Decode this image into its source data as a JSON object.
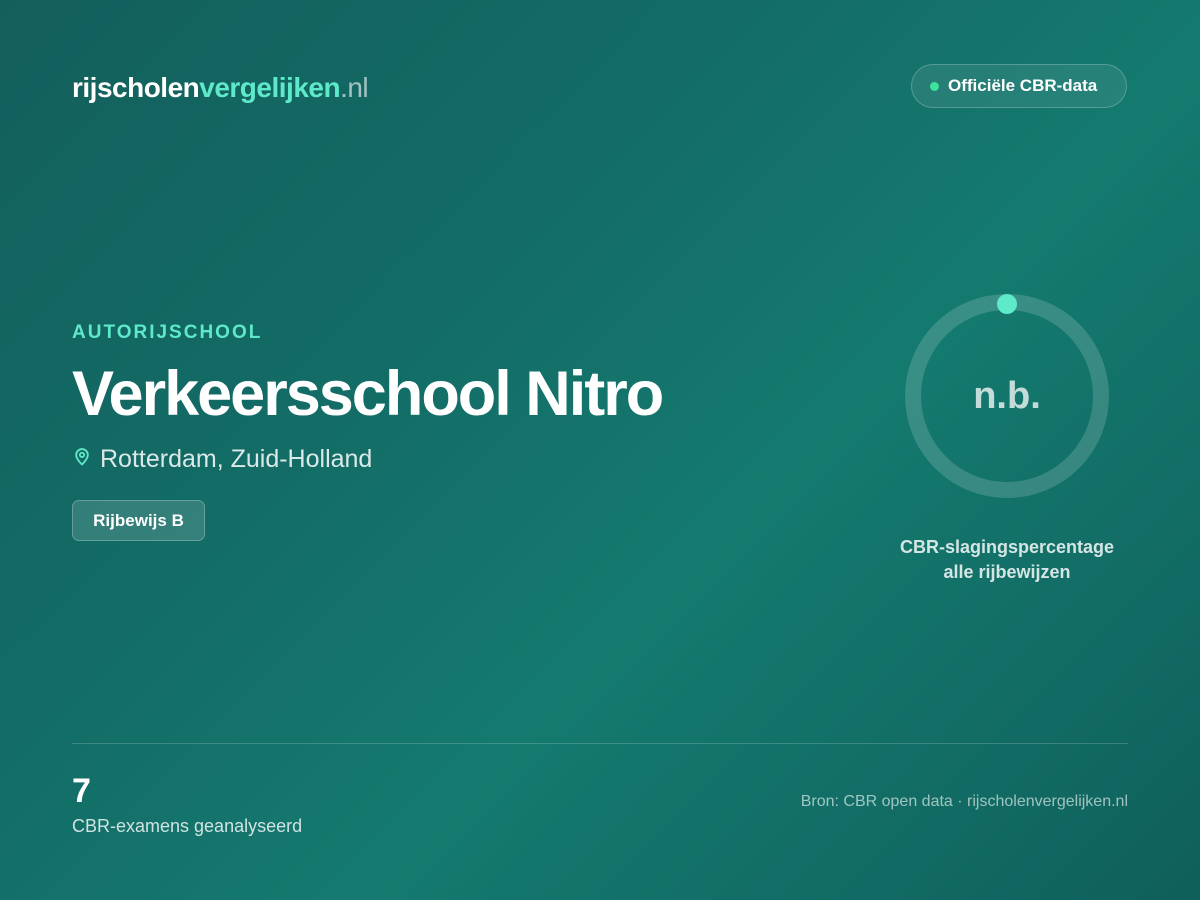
{
  "brand": {
    "part1": "rijscholen",
    "part2": "vergelijken",
    "part3": ".nl"
  },
  "badge": {
    "label": "Officiële CBR-data"
  },
  "school": {
    "kicker": "AUTORIJSCHOOL",
    "name": "Verkeersschool Nitro",
    "location": "Rotterdam, Zuid-Holland",
    "license": "Rijbewijs B"
  },
  "pass_rate": {
    "value": "n.b.",
    "label_line1": "CBR-slagingspercentage",
    "label_line2": "alle rijbewijzen"
  },
  "stats": {
    "exams_count": "7",
    "exams_label": "CBR-examens geanalyseerd"
  },
  "footer": {
    "source": "Bron: CBR open data · rijscholenvergelijken.nl"
  },
  "colors": {
    "accent": "#5ee9c9",
    "status_dot": "#3ee39a",
    "background": "#136c66"
  },
  "icons": {
    "location": "map-pin-icon",
    "status": "status-dot-icon"
  }
}
